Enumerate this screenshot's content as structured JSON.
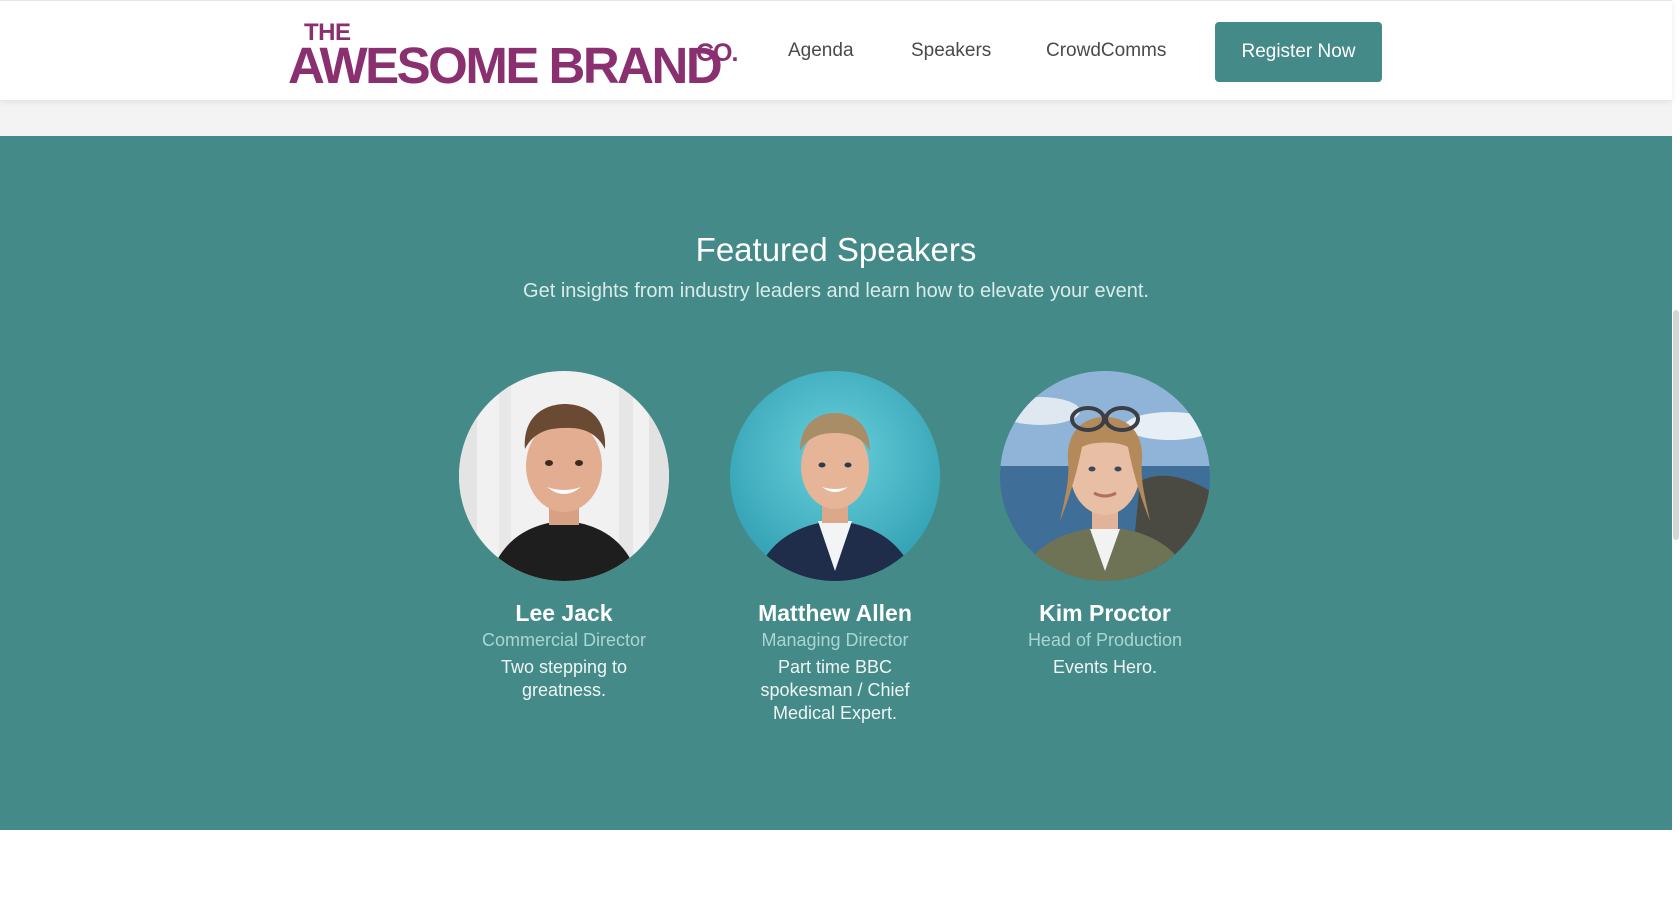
{
  "header": {
    "logo": {
      "the": "THE",
      "main": "AWESOME BRAND",
      "co": "CO."
    },
    "nav": [
      {
        "label": "Agenda"
      },
      {
        "label": "Speakers"
      },
      {
        "label": "CrowdComms"
      }
    ],
    "cta": {
      "label": "Register Now"
    }
  },
  "featured": {
    "title": "Featured Speakers",
    "subtitle": "Get insights from industry leaders and learn how to elevate your event.",
    "speakers": [
      {
        "name": "Lee Jack",
        "role": "Commercial Director",
        "bio": "Two stepping to greatness."
      },
      {
        "name": "Matthew Allen",
        "role": "Managing Director",
        "bio": "Part time BBC spokesman / Chief Medical Expert."
      },
      {
        "name": "Kim Proctor",
        "role": "Head of Production",
        "bio": "Events Hero."
      }
    ]
  },
  "colors": {
    "brand": "#8a2f6f",
    "teal": "#448a88",
    "role_text": "#a9d6d3"
  }
}
